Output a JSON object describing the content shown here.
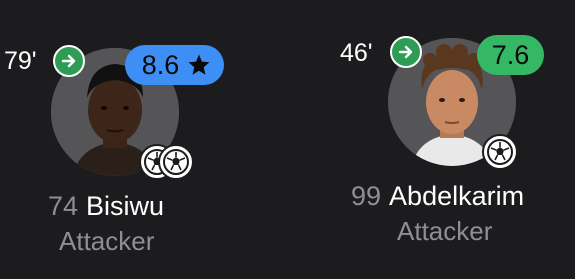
{
  "players": [
    {
      "sub_minute": "79'",
      "rating": "8.6",
      "rating_color": "#3d8ef5",
      "motm": true,
      "goals": 2,
      "number": "74",
      "name": "Bisiwu",
      "position": "Attacker",
      "icons": [
        "substitution-in-icon",
        "star-icon",
        "football-icon"
      ]
    },
    {
      "sub_minute": "46'",
      "rating": "7.6",
      "rating_color": "#35b865",
      "motm": false,
      "goals": 1,
      "number": "99",
      "name": "Abdelkarim",
      "position": "Attacker",
      "icons": [
        "substitution-in-icon",
        "football-icon"
      ]
    }
  ]
}
